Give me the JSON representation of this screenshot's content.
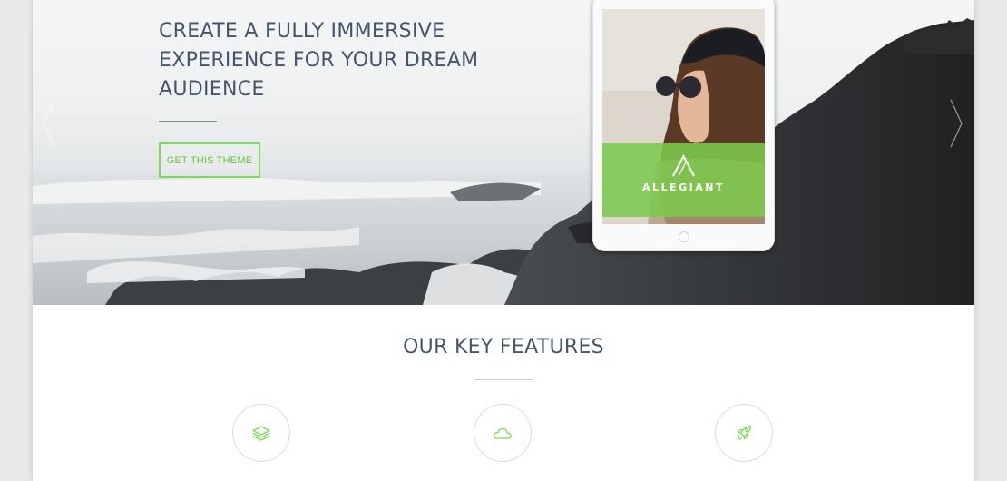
{
  "hero": {
    "headline_lines": [
      "CREATE A FULLY IMMERSIVE",
      "EXPERIENCE FOR YOUR DREAM",
      "AUDIENCE"
    ],
    "cta_label": "GET THIS THEME",
    "prev_arrow_icon": "chevron-left-icon",
    "next_arrow_icon": "chevron-right-icon",
    "tablet": {
      "brand_name": "ALLEGIANT",
      "logo_icon": "allegiant-logo-icon"
    }
  },
  "features": {
    "title": "OUR KEY FEATURES",
    "items": [
      {
        "icon": "layers-icon"
      },
      {
        "icon": "cloud-icon"
      },
      {
        "icon": "rocket-icon"
      }
    ]
  },
  "colors": {
    "accent_green": "#7ed957",
    "heading_text": "#46566a",
    "tablet_band": "#7cc94f"
  }
}
